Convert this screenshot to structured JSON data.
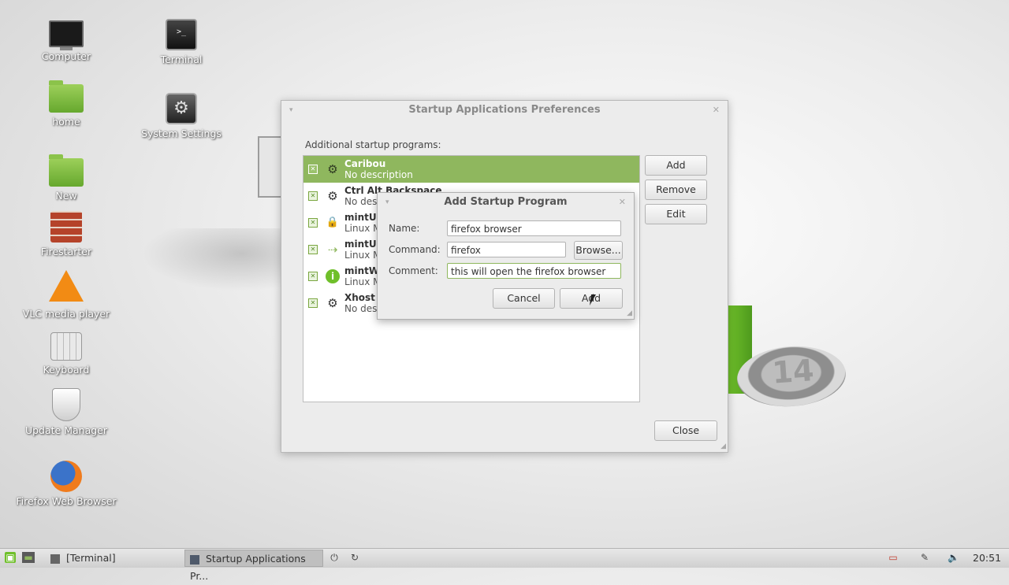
{
  "desktop": {
    "icons": [
      {
        "label": "Computer",
        "icon": "computer-icon"
      },
      {
        "label": "Terminal",
        "icon": "terminal-icon"
      },
      {
        "label": "home",
        "icon": "home-folder-icon"
      },
      {
        "label": "System Settings",
        "icon": "settings-icon"
      },
      {
        "label": "New",
        "icon": "folder-icon"
      },
      {
        "label": "Firestarter",
        "icon": "firewall-icon"
      },
      {
        "label": "VLC media player",
        "icon": "vlc-icon"
      },
      {
        "label": "Keyboard",
        "icon": "keyboard-icon"
      },
      {
        "label": "Update Manager",
        "icon": "shield-icon"
      },
      {
        "label": "Firefox Web Browser",
        "icon": "firefox-icon"
      }
    ],
    "logo_number": "14",
    "terminal_glyph": ">_"
  },
  "window": {
    "title": "Startup Applications Preferences",
    "list_label": "Additional startup programs:",
    "programs": [
      {
        "name": "Caribou",
        "desc": "No description",
        "icon": "gear-icon",
        "checked": true,
        "selected": true
      },
      {
        "name": "Ctrl Alt Backspace",
        "desc": "No desc",
        "icon": "gear-icon",
        "checked": true
      },
      {
        "name": "mintU",
        "desc": "Linux M",
        "icon": "lock-icon",
        "checked": true
      },
      {
        "name": "mintU",
        "desc": "Linux M",
        "icon": "update-icon",
        "checked": true
      },
      {
        "name": "mintW",
        "desc": "Linux M",
        "icon": "info-icon",
        "checked": true
      },
      {
        "name": "Xhost",
        "desc": "No desc",
        "icon": "gear-icon",
        "checked": true
      }
    ],
    "buttons": {
      "add": "Add",
      "remove": "Remove",
      "edit": "Edit",
      "close": "Close"
    }
  },
  "dialog": {
    "title": "Add Startup Program",
    "name_label": "Name:",
    "name_value": "firefox browser",
    "command_label": "Command:",
    "command_value": "firefox",
    "browse": "Browse...",
    "comment_label": "Comment:",
    "comment_value": "this will open the firefox browser",
    "cancel": "Cancel",
    "add": "Add"
  },
  "panel": {
    "tasks": [
      {
        "label": "[Terminal]",
        "active": false
      },
      {
        "label": "Startup Applications Pr...",
        "active": true
      }
    ],
    "clock": "20:51"
  },
  "colors": {
    "accent": "#8fb75e",
    "mint_green": "#6fbf2a"
  }
}
